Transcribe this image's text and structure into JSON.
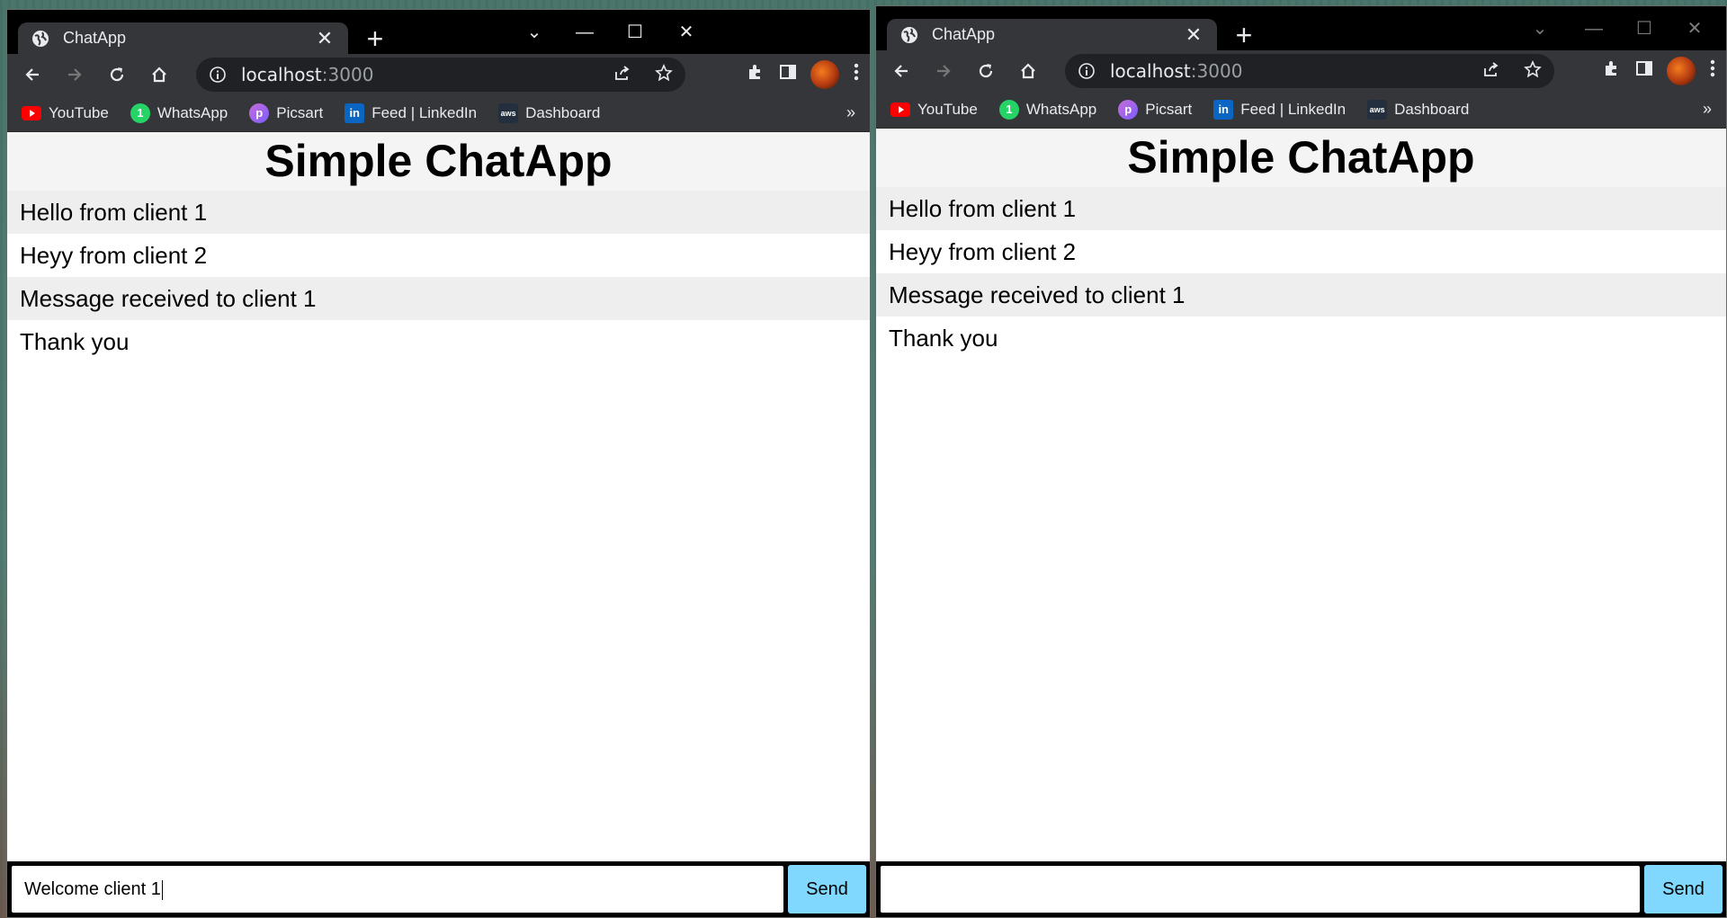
{
  "colors": {
    "send_button": "#80d8ff",
    "chrome_dark": "#202124",
    "tab_active": "#35363a"
  },
  "windows": [
    {
      "tab_title": "ChatApp",
      "url_host": "localhost",
      "url_port": ":3000",
      "bookmarks": [
        {
          "label": "YouTube",
          "icon": "youtube-icon"
        },
        {
          "label": "WhatsApp",
          "icon": "whatsapp-icon"
        },
        {
          "label": "Picsart",
          "icon": "picsart-icon"
        },
        {
          "label": "Feed | LinkedIn",
          "icon": "linkedin-icon"
        },
        {
          "label": "Dashboard",
          "icon": "aws-icon"
        }
      ],
      "bookmarks_more": "»",
      "app_title": "Simple ChatApp",
      "messages": [
        "Hello from client 1",
        "Heyy from client 2",
        "Message received to client 1",
        "Thank you"
      ],
      "input_value": "Welcome client 1",
      "send_label": "Send"
    },
    {
      "tab_title": "ChatApp",
      "url_host": "localhost",
      "url_port": ":3000",
      "bookmarks": [
        {
          "label": "YouTube",
          "icon": "youtube-icon"
        },
        {
          "label": "WhatsApp",
          "icon": "whatsapp-icon"
        },
        {
          "label": "Picsart",
          "icon": "picsart-icon"
        },
        {
          "label": "Feed | LinkedIn",
          "icon": "linkedin-icon"
        },
        {
          "label": "Dashboard",
          "icon": "aws-icon"
        }
      ],
      "bookmarks_more": "»",
      "app_title": "Simple ChatApp",
      "messages": [
        "Hello from client 1",
        "Heyy from client 2",
        "Message received to client 1",
        "Thank you"
      ],
      "input_value": "",
      "send_label": "Send"
    }
  ]
}
